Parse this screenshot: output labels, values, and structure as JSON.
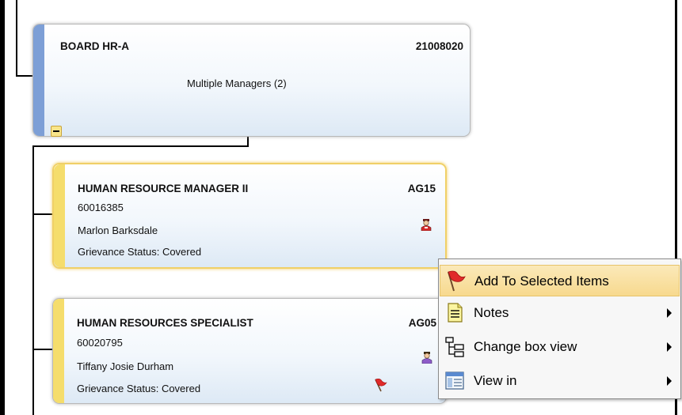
{
  "org_chart": {
    "parent": {
      "title": "BOARD HR-A",
      "code": "21008020",
      "subtitle": "Multiple Managers (2)"
    },
    "children": [
      {
        "title": "HUMAN RESOURCE MANAGER II",
        "grade": "AG15",
        "position_number": "60016385",
        "employee": "Marlon Barksdale",
        "status": "Grievance Status: Covered",
        "person_icon": "person-red-icon"
      },
      {
        "title": "HUMAN RESOURCES SPECIALIST",
        "grade": "AG05",
        "position_number": "60020795",
        "employee": "Tiffany Josie Durham",
        "status": "Grievance Status: Covered",
        "person_icon": "person-purple-icon",
        "flagged": true
      }
    ]
  },
  "context_menu": {
    "items": [
      {
        "label": "Add To Selected Items",
        "icon": "red-flag-icon",
        "highlighted": true,
        "submenu": false
      },
      {
        "label": "Notes",
        "icon": "notes-icon",
        "submenu": true
      },
      {
        "label": "Change box view",
        "icon": "tree-view-icon",
        "submenu": true
      },
      {
        "label": "View in",
        "icon": "window-icon",
        "submenu": true
      }
    ]
  },
  "colors": {
    "parent_stripe": "#7d9fd6",
    "child_stripe": "#f5dd6c",
    "menu_highlight": "#f7d98e"
  }
}
